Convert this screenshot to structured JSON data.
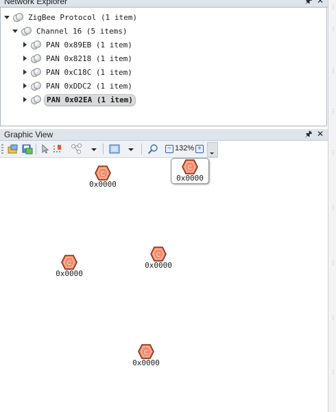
{
  "network_explorer": {
    "title": "Network Explorer",
    "pin_icon": "pin-icon",
    "close_icon": "close-icon",
    "tree": {
      "root": "ZigBee Protocol (1 item)",
      "channel": "Channel 16 (5 items)",
      "pans": [
        {
          "label": "PAN 0x89EB (1 item)",
          "selected": false
        },
        {
          "label": "PAN 0x8218 (1 item)",
          "selected": false
        },
        {
          "label": "PAN 0xC18C (1 item)",
          "selected": false
        },
        {
          "label": "PAN 0xDDC2 (1 item)",
          "selected": false
        },
        {
          "label": "PAN 0x02EA (1 item)",
          "selected": true
        }
      ]
    }
  },
  "graphic_view": {
    "title": "Graphic View",
    "toolbar": {
      "zoom_level": "132%",
      "icons": [
        "open-layout-icon",
        "save-layout-icon",
        "select-pointer-icon",
        "hand-grid-icon",
        "network-layout-icon",
        "layout-dropdown-icon",
        "frame-view-icon",
        "frame-dropdown-icon",
        "zoom-search-icon",
        "zoom-out-icon",
        "zoom-in-icon"
      ]
    },
    "nodes": [
      {
        "letter": "C",
        "address": "0x0000",
        "selected": false
      },
      {
        "letter": "C",
        "address": "0x0000",
        "selected": true
      },
      {
        "letter": "C",
        "address": "0x0000",
        "selected": false
      },
      {
        "letter": "C",
        "address": "0x0000",
        "selected": false
      },
      {
        "letter": "C",
        "address": "0x0000",
        "selected": false
      }
    ],
    "colors": {
      "node_fill": "#f08a6a",
      "node_border": "#8a2a12"
    }
  }
}
